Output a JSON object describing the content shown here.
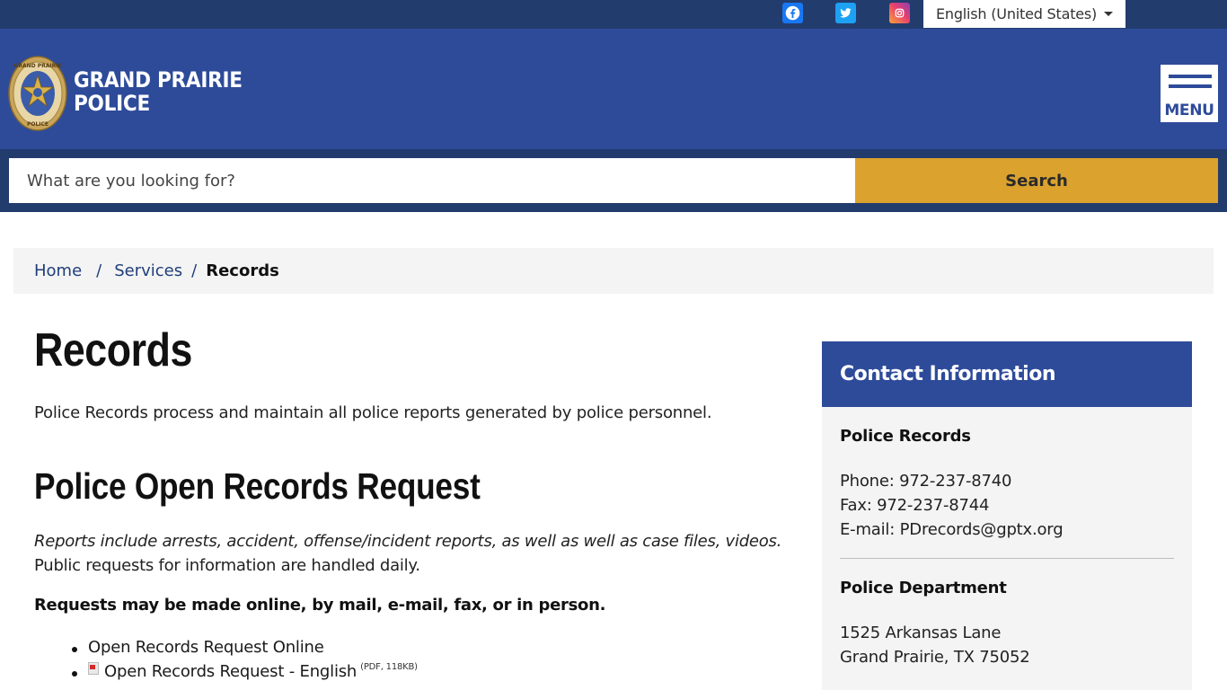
{
  "topbar": {
    "social": [
      "facebook-icon",
      "twitter-icon",
      "instagram-icon"
    ],
    "language": "English (United States)"
  },
  "header": {
    "brand_line1": "GRAND PRAIRIE",
    "brand_line2": "POLICE",
    "badge_text_top": "GRAND PRAIRIE",
    "badge_text_bottom": "POLICE",
    "menu_label": "MENU"
  },
  "search": {
    "placeholder": "What are you looking for?",
    "button_label": "Search"
  },
  "breadcrumb": {
    "items": [
      "Home",
      "Services"
    ],
    "current": "Records",
    "separator": "/"
  },
  "main": {
    "title": "Records",
    "intro": "Police Records process and maintain all police reports generated by police personnel.",
    "section_title": "Police Open Records Request",
    "para_italic": "Reports include arrests, accident, offense/incident reports, as well as well as case files, videos.",
    "para_normal": "Public requests for information are handled daily.",
    "requests_before": "Requests may be made online, by mail, ",
    "requests_link": "e-mail",
    "requests_after": ", fax, or in person.",
    "links": [
      {
        "label": "Open Records Request Online",
        "meta": ""
      },
      {
        "label": "Open Records Request - English",
        "meta": "(PDF, 118KB)"
      }
    ]
  },
  "sidebar": {
    "title": "Contact Information",
    "records": {
      "heading": "Police Records",
      "phone_label": "Phone: ",
      "phone": "972-237-8740",
      "fax_label": "Fax: ",
      "fax": "972-237-8744",
      "email_label": "E-mail: ",
      "email": "PDrecords@gptx.org"
    },
    "department": {
      "heading": "Police Department",
      "address1": "1525 Arkansas Lane",
      "address2": "Grand Prairie, TX 75052"
    }
  },
  "colors": {
    "topbar": "#233c6e",
    "header": "#2e4b9a",
    "search_button": "#dba22e",
    "breadcrumb_bg": "#f4f4f4"
  }
}
